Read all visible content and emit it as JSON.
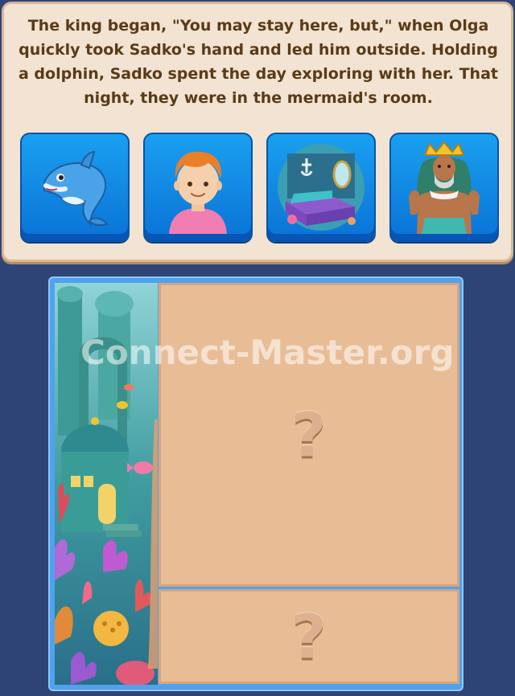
{
  "story": {
    "text": "The king began, \"You may stay here, but,\" when Olga quickly took Sadko's hand and led him outside. Holding a dolphin, Sadko spent the day exploring with her. That night, they were in the mermaid's room."
  },
  "choices": [
    {
      "icon": "dolphin-icon"
    },
    {
      "icon": "boy-icon"
    },
    {
      "icon": "bedroom-icon"
    },
    {
      "icon": "sea-king-icon"
    }
  ],
  "board": {
    "slots": [
      {
        "label": "?"
      },
      {
        "label": "?"
      }
    ]
  },
  "watermark": "Connect-Master.org",
  "colors": {
    "background": "#2f4476",
    "panel": "#f2e3d2",
    "choice": "#1a8fe8",
    "slot": "#e8bd96",
    "text": "#5a3b17"
  }
}
